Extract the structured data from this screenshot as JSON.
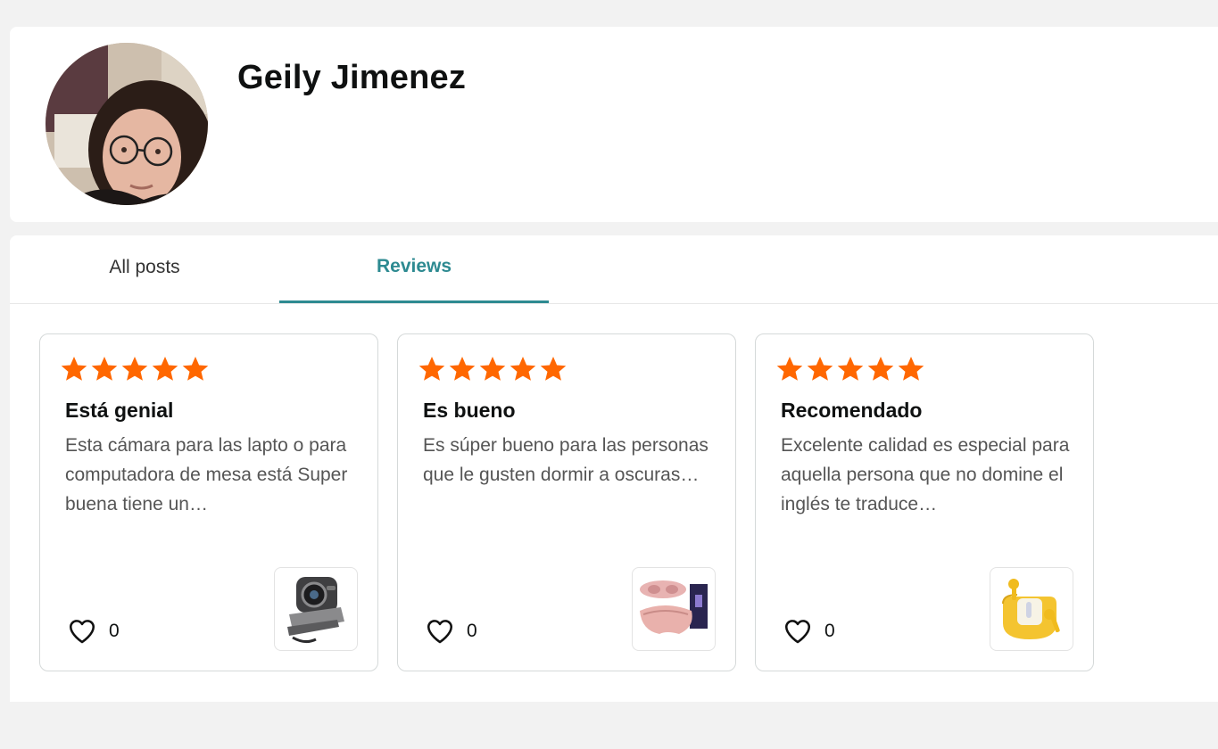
{
  "profile": {
    "name": "Geily Jimenez"
  },
  "tabs": [
    {
      "label": "All posts",
      "active": false
    },
    {
      "label": "Reviews",
      "active": true
    }
  ],
  "reviews": [
    {
      "rating": 5,
      "title": "Está genial",
      "text": "Esta cámara para las lapto o para computadora de mesa está Super buena tiene un…",
      "likes": "0",
      "product_icon": "webcam-icon"
    },
    {
      "rating": 5,
      "title": "Es bueno",
      "text": "Es súper bueno para las personas que le gusten dormir a oscuras…",
      "likes": "0",
      "product_icon": "sleep-mask-icon"
    },
    {
      "rating": 5,
      "title": "Recomendado",
      "text": "Excelente calidad es especial para aquella persona que no domine el inglés te traduce…",
      "likes": "0",
      "product_icon": "earbuds-icon"
    }
  ],
  "colors": {
    "star": "#ff6700",
    "active_tab": "#2d8a91",
    "page_bg": "#f2f2f2"
  }
}
